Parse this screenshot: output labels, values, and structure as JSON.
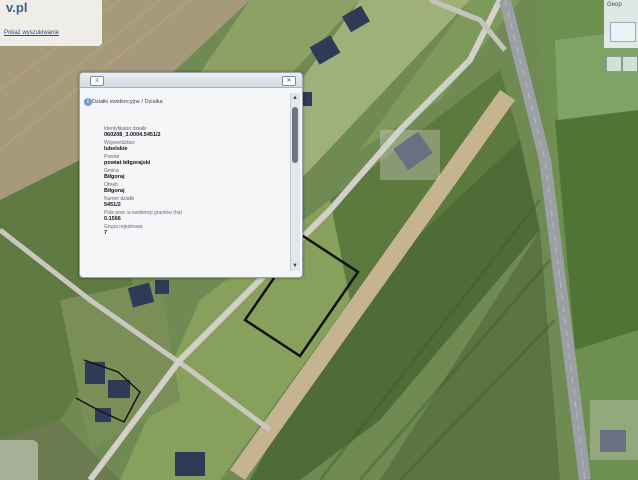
{
  "logo": {
    "brand": "v.pl",
    "link": "Pokaż wyszukiwanie"
  },
  "layers_panel": {
    "label": "Geop"
  },
  "popup": {
    "header": "Działki ewidencyjne / Działka",
    "fields": [
      {
        "label": "Identyfikator działki",
        "value": "060208_3.0004.5451/2"
      },
      {
        "label": "Województwo",
        "value": "lubelskie"
      },
      {
        "label": "Powiat",
        "value": "powiat biłgorajski"
      },
      {
        "label": "Gmina",
        "value": "Biłgoraj"
      },
      {
        "label": "Obręb",
        "value": "Biłgoraj"
      },
      {
        "label": "Numer działki",
        "value": "5451/2"
      },
      {
        "label": "Pole pow. w ewidencji gruntów (ha)",
        "value": "0.1566"
      },
      {
        "label": "Grupa rejestrowa",
        "value": "7"
      }
    ]
  },
  "icons": {
    "close": "close-icon",
    "info": "info-icon",
    "layers": "layers-icon"
  }
}
